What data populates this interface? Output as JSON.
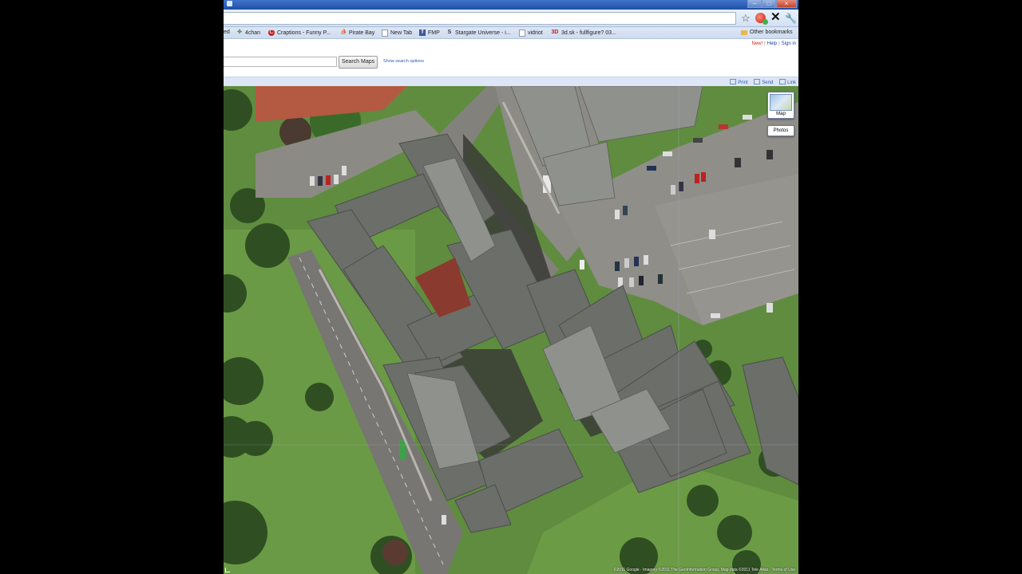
{
  "window": {
    "minimize": "–",
    "maximize": "□",
    "close": "×"
  },
  "toolbar": {
    "star_icon": "star-icon",
    "stop_symbol": "✕",
    "wrench_symbol": "🔧"
  },
  "bookmarks": {
    "items": [
      {
        "label": "ed"
      },
      {
        "label": "4chan"
      },
      {
        "label": "Craptions - Funny P..."
      },
      {
        "label": "Pirate Bay"
      },
      {
        "label": "New Tab"
      },
      {
        "label": "FMP"
      },
      {
        "label": "Stargate Universe - i..."
      },
      {
        "label": "vidriot"
      },
      {
        "label": "3d.sk - fullfigure? 03..."
      }
    ],
    "other": "Other bookmarks"
  },
  "maps": {
    "toplinks": {
      "new": "New!",
      "help": "Help",
      "signin": "Sign in"
    },
    "search_button": "Search Maps",
    "search_options": "Show search options",
    "strip_links": {
      "print": "Print",
      "send": "Send",
      "link": "Link"
    },
    "map_button": "Map",
    "photos_button": "Photos",
    "copyright": "©2011 Google · Imagery ©2011 The GeoInformation Group, Map data ©2011 Tele Atlas · Terms of Use"
  },
  "colors": {
    "grass": "#5d8a3e",
    "roof": "#6a6d68",
    "road": "#7a7a76",
    "accent_blue": "#1a3fae"
  }
}
